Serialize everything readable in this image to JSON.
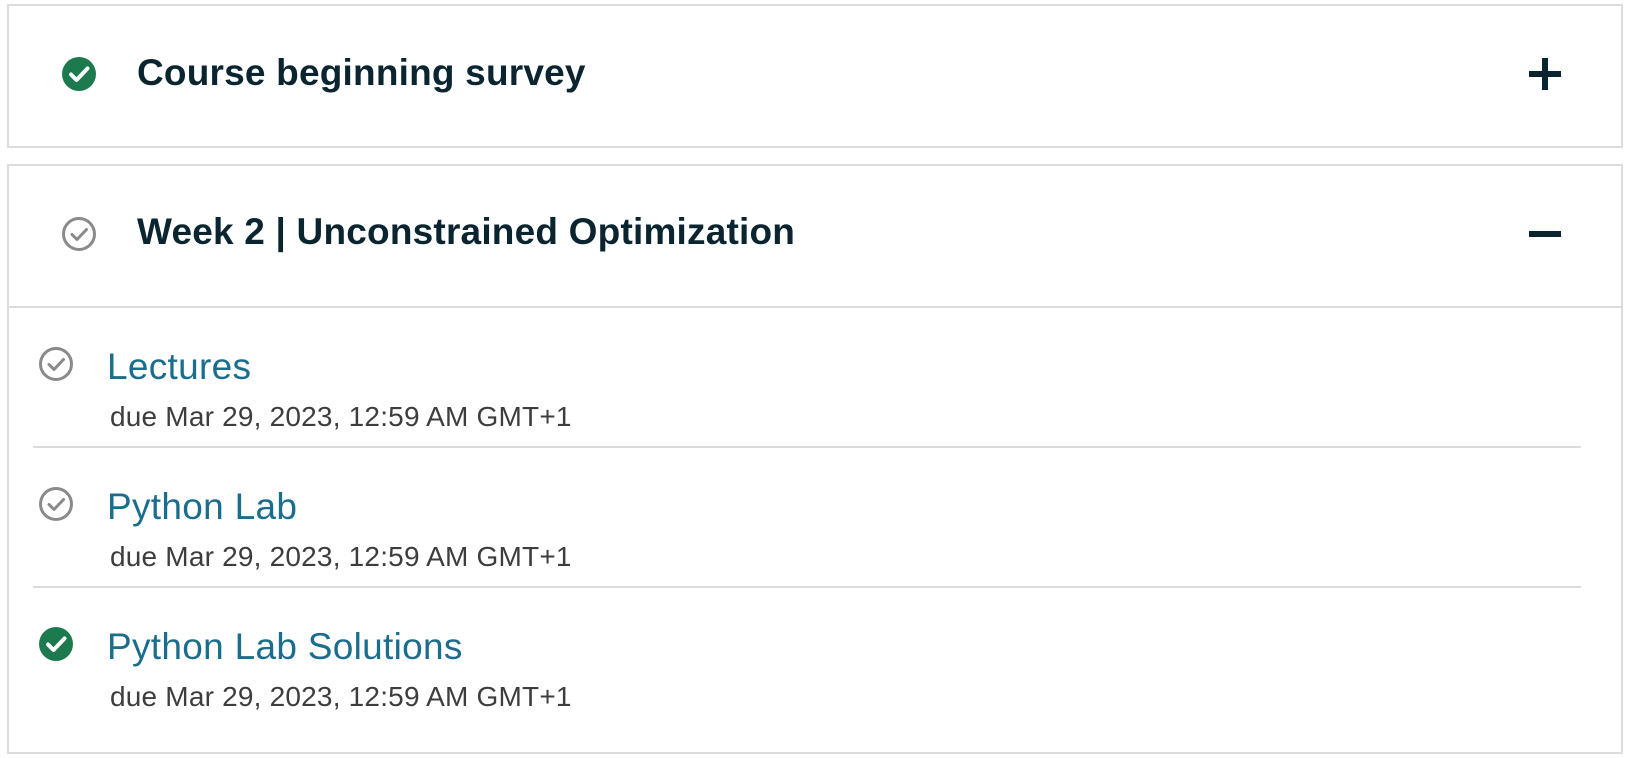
{
  "sections": [
    {
      "title": "Course beginning survey",
      "status_icon": "check-filled-icon",
      "toggle_icon": "plus-icon",
      "expanded": false
    },
    {
      "title": "Week 2 | Unconstrained Optimization",
      "status_icon": "check-outline-icon",
      "toggle_icon": "minus-icon",
      "expanded": true,
      "items": [
        {
          "label": "Lectures",
          "due": "due Mar 29, 2023, 12:59 AM GMT+1",
          "status_icon": "check-outline-icon"
        },
        {
          "label": "Python Lab",
          "due": "due Mar 29, 2023, 12:59 AM GMT+1",
          "status_icon": "check-outline-icon"
        },
        {
          "label": "Python Lab Solutions",
          "due": "due Mar 29, 2023, 12:59 AM GMT+1",
          "status_icon": "check-filled-icon"
        }
      ]
    }
  ],
  "colors": {
    "complete_green": "#1d7a4f",
    "incomplete_gray": "#8a8a8a",
    "link_blue": "#1a6d8c",
    "title_dark": "#0b2530",
    "border": "#dcdcdc"
  }
}
